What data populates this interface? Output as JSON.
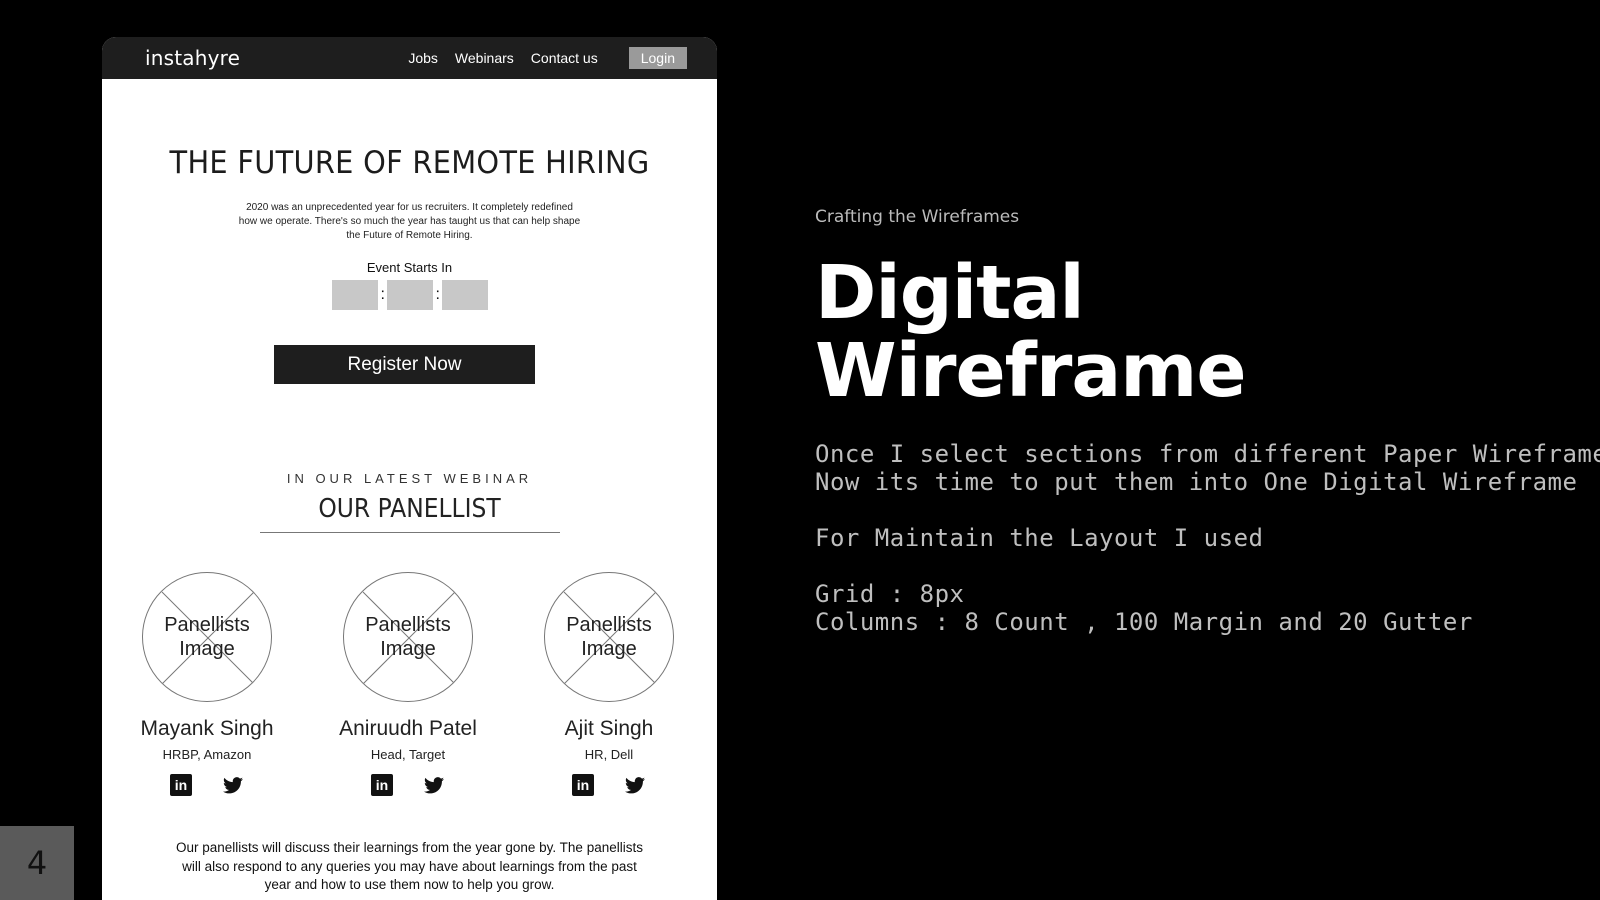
{
  "slide": {
    "page_number": "4"
  },
  "wireframe": {
    "nav": {
      "brand": "instahyre",
      "links": [
        "Jobs",
        "Webinars",
        "Contact us"
      ],
      "login": "Login"
    },
    "hero": {
      "title": "THE FUTURE OF REMOTE HIRING",
      "description_lines": [
        "2020 was an unprecedented year for us recruiters. It completely redefined",
        "how we operate. There's so much the year has taught us that can help shape",
        "the Future of Remote Hiring."
      ],
      "event_label": "Event Starts In",
      "countdown_sep": ":",
      "register": "Register Now"
    },
    "panel_section": {
      "eyebrow": "IN OUR LATEST WEBINAR",
      "title": "OUR PANELLIST",
      "image_placeholder_line1": "Panellists",
      "image_placeholder_line2": "Image",
      "panelists": [
        {
          "name": "Mayank Singh",
          "role": "HRBP, Amazon"
        },
        {
          "name": "Aniruudh Patel",
          "role": "Head, Target"
        },
        {
          "name": "Ajit Singh",
          "role": "HR, Dell"
        }
      ],
      "linkedin_glyph": "in",
      "closing_lines": [
        "Our panellists will discuss their learnings from the year gone by. The panellists",
        "will also respond to any queries you may have about learnings from the past",
        "year and how to use them now to help you grow."
      ]
    }
  },
  "description": {
    "kicker": "Crafting the Wireframes",
    "title_line1": "Digital",
    "title_line2": "Wireframe",
    "para1_line1": "Once I select sections from different Paper Wireframes",
    "para1_line2": "Now its time to put them into One Digital Wireframe",
    "para2": "For Maintain the Layout I used",
    "para3_line1": "Grid : 8px",
    "para3_line2": "Columns : 8 Count , 100 Margin and 20 Gutter"
  }
}
